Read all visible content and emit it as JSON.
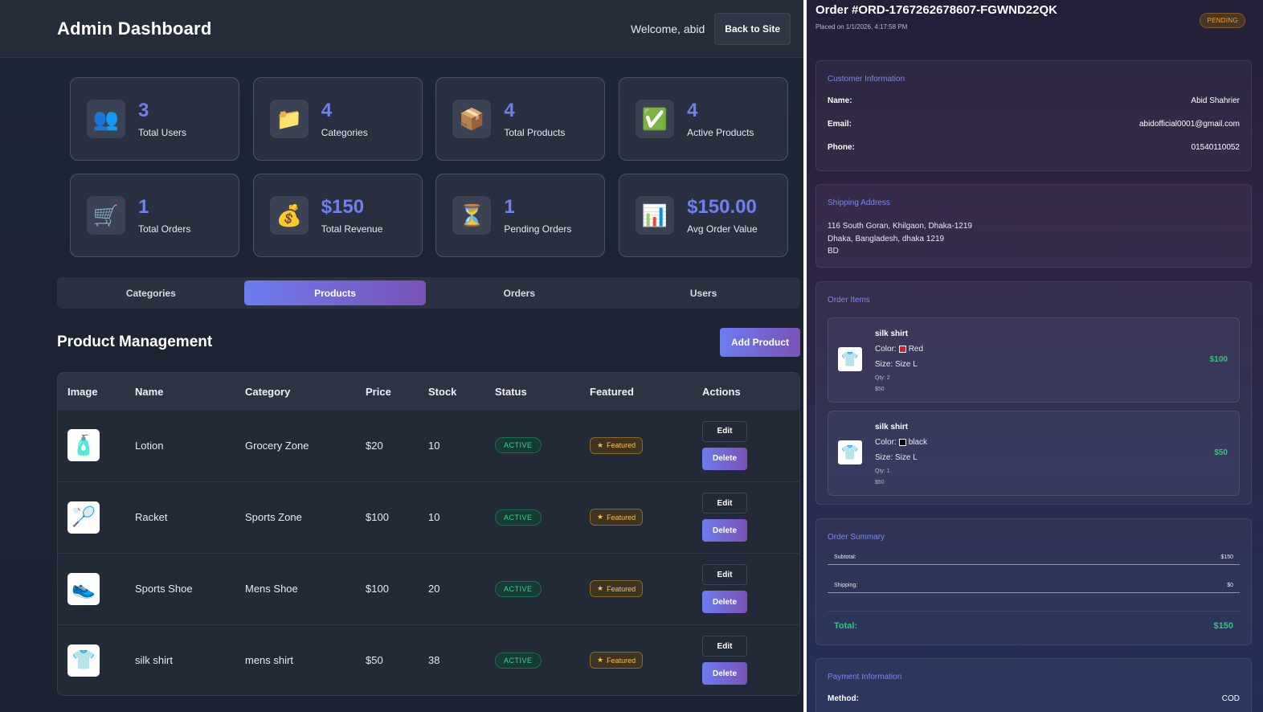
{
  "header": {
    "title": "Admin Dashboard",
    "welcome": "Welcome, abid",
    "back_label": "Back to Site"
  },
  "stats": [
    {
      "icon": "users-icon",
      "glyph": "👥",
      "value": "3",
      "label": "Total Users"
    },
    {
      "icon": "folder-icon",
      "glyph": "📁",
      "value": "4",
      "label": "Categories"
    },
    {
      "icon": "package-icon",
      "glyph": "📦",
      "value": "4",
      "label": "Total Products"
    },
    {
      "icon": "check-icon",
      "glyph": "✅",
      "value": "4",
      "label": "Active Products"
    },
    {
      "icon": "cart-icon",
      "glyph": "🛒",
      "value": "1",
      "label": "Total Orders"
    },
    {
      "icon": "money-bag-icon",
      "glyph": "💰",
      "value": "$150",
      "label": "Total Revenue"
    },
    {
      "icon": "hourglass-icon",
      "glyph": "⏳",
      "value": "1",
      "label": "Pending Orders"
    },
    {
      "icon": "chart-icon",
      "glyph": "📊",
      "value": "$150.00",
      "label": "Avg Order Value"
    }
  ],
  "tabs": [
    {
      "label": "Categories",
      "active": false
    },
    {
      "label": "Products",
      "active": true
    },
    {
      "label": "Orders",
      "active": false
    },
    {
      "label": "Users",
      "active": false
    }
  ],
  "products_section": {
    "title": "Product Management",
    "add_label": "Add Product",
    "columns": [
      "Image",
      "Name",
      "Category",
      "Price",
      "Stock",
      "Status",
      "Featured",
      "Actions"
    ],
    "rows": [
      {
        "glyph": "🧴",
        "name": "Lotion",
        "category": "Grocery Zone",
        "price": "$20",
        "stock": "10",
        "status": "ACTIVE",
        "featured": "Featured"
      },
      {
        "glyph": "🏸",
        "name": "Racket",
        "category": "Sports Zone",
        "price": "$100",
        "stock": "10",
        "status": "ACTIVE",
        "featured": "Featured"
      },
      {
        "glyph": "👟",
        "name": "Sports Shoe",
        "category": "Mens Shoe",
        "price": "$100",
        "stock": "20",
        "status": "ACTIVE",
        "featured": "Featured"
      },
      {
        "glyph": "👕",
        "name": "silk shirt",
        "category": "mens shirt",
        "price": "$50",
        "stock": "38",
        "status": "ACTIVE",
        "featured": "Featured"
      }
    ],
    "edit_label": "Edit",
    "delete_label": "Delete",
    "star_glyph": "★"
  },
  "order": {
    "title": "Order #ORD-1767262678607-FGWND22QK",
    "placed": "Placed on 1/1/2026, 4:17:58 PM",
    "status": "PENDING",
    "customer": {
      "title": "Customer Information",
      "name_label": "Name:",
      "name": "Abid Shahrier",
      "email_label": "Email:",
      "email": "abidofficial0001@gmail.com",
      "phone_label": "Phone:",
      "phone": "01540110052"
    },
    "shipping": {
      "title": "Shipping Address",
      "line1": "116 South Goran, Khilgaon, Dhaka-1219",
      "line2": "Dhaka, Bangladesh, dhaka 1219",
      "line3": "BD"
    },
    "items_title": "Order Items",
    "items": [
      {
        "glyph": "👕",
        "name": "silk shirt",
        "color_label": "Color:",
        "color": "Red",
        "swatch": "#d0202a",
        "size": "Size: Size L",
        "qty": "Qty: 2",
        "unit": "$50",
        "total": "$100"
      },
      {
        "glyph": "👕",
        "name": "silk shirt",
        "color_label": "Color:",
        "color": "black",
        "swatch": "#000000",
        "size": "Size: Size L",
        "qty": "Qty: 1",
        "unit": "$50",
        "total": "$50"
      }
    ],
    "summary": {
      "title": "Order Summary",
      "subtotal_label": "Subtotal:",
      "subtotal": "$150",
      "shipping_label": "Shipping:",
      "shipping": "$0",
      "total_label": "Total:",
      "total": "$150"
    },
    "payment": {
      "title": "Payment Information",
      "method_label": "Method:",
      "method": "COD"
    }
  },
  "colors": {
    "accent": "#6c7cf0",
    "accent2": "#7a52b6",
    "success": "#3fd29a",
    "featured": "#f6c047",
    "pending": "#f2a033"
  }
}
